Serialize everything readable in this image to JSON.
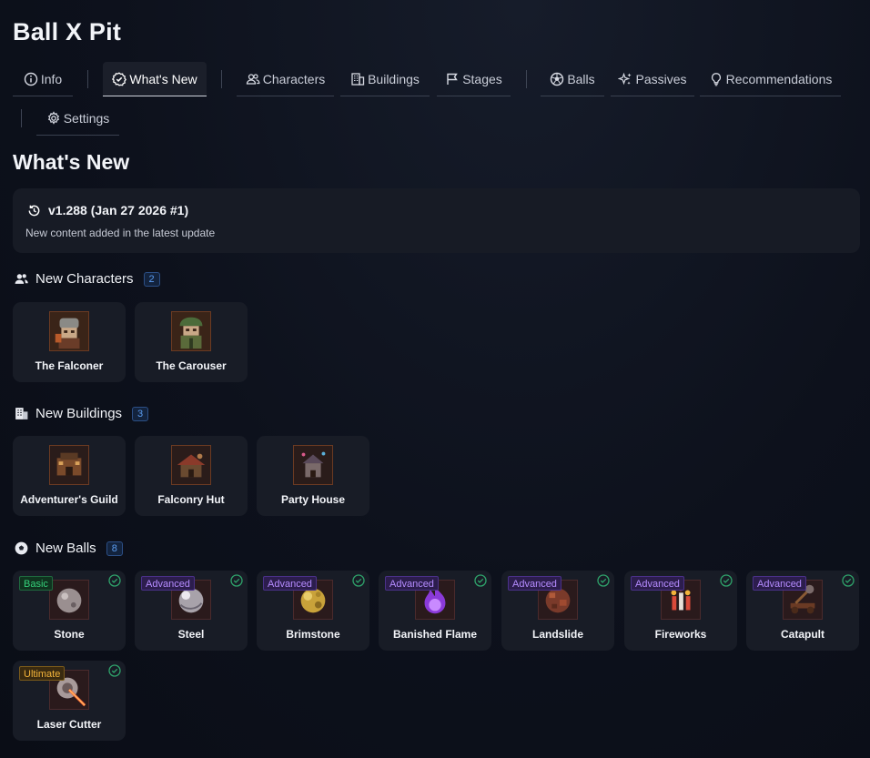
{
  "app": {
    "title": "Ball X Pit"
  },
  "tabs": [
    {
      "label": "Info",
      "icon": "info-icon"
    },
    {
      "label": "What's New",
      "icon": "check-badge-icon",
      "active": true
    },
    {
      "label": "Characters",
      "icon": "users-icon"
    },
    {
      "label": "Buildings",
      "icon": "building-icon"
    },
    {
      "label": "Stages",
      "icon": "flag-icon"
    },
    {
      "label": "Balls",
      "icon": "ball-icon"
    },
    {
      "label": "Passives",
      "icon": "sparkles-icon"
    },
    {
      "label": "Recommendations",
      "icon": "lightbulb-icon"
    },
    {
      "label": "Settings",
      "icon": "gear-icon"
    }
  ],
  "page": {
    "title": "What's New"
  },
  "version": {
    "text": "v1.288 (Jan 27 2026 #1)",
    "description": "New content added in the latest update",
    "icon": "history-icon"
  },
  "characters": {
    "title": "New Characters",
    "count": "2",
    "icon": "users-icon",
    "items": [
      {
        "name": "The Falconer"
      },
      {
        "name": "The Carouser"
      }
    ]
  },
  "buildings": {
    "title": "New Buildings",
    "count": "3",
    "icon": "building-icon",
    "items": [
      {
        "name": "Adventurer's Guild"
      },
      {
        "name": "Falconry Hut"
      },
      {
        "name": "Party House"
      }
    ]
  },
  "balls": {
    "title": "New Balls",
    "count": "8",
    "icon": "ball-icon",
    "items": [
      {
        "name": "Stone",
        "rarity": "Basic"
      },
      {
        "name": "Steel",
        "rarity": "Advanced"
      },
      {
        "name": "Brimstone",
        "rarity": "Advanced"
      },
      {
        "name": "Banished Flame",
        "rarity": "Advanced"
      },
      {
        "name": "Landslide",
        "rarity": "Advanced"
      },
      {
        "name": "Fireworks",
        "rarity": "Advanced"
      },
      {
        "name": "Catapult",
        "rarity": "Advanced"
      },
      {
        "name": "Laser Cutter",
        "rarity": "Ultimate"
      }
    ]
  },
  "colors": {
    "accent_blue": "#5b9cf0",
    "basic_green": "#35d07a",
    "advanced_purple": "#b58cff",
    "ultimate_gold": "#f2b33a",
    "check_green": "#2fa36b"
  }
}
